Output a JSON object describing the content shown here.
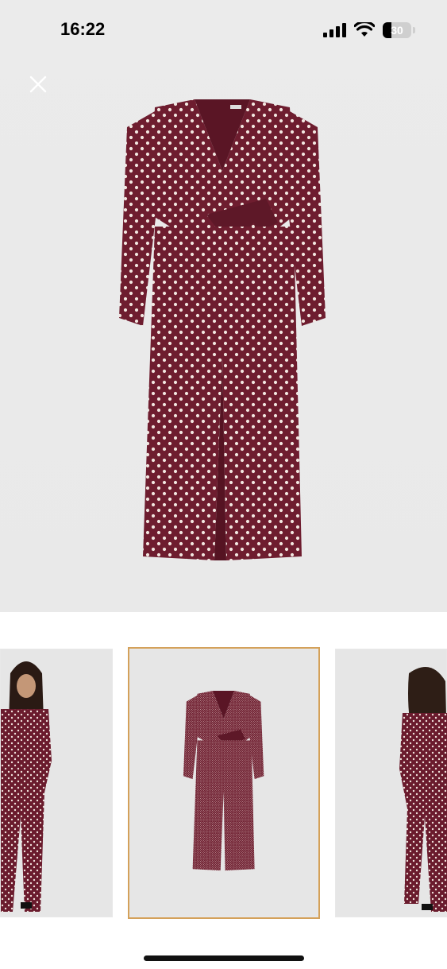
{
  "status_bar": {
    "time": "16:22",
    "battery_level": "30",
    "signal_bars": 4,
    "icons": [
      "signal-icon",
      "wifi-icon",
      "battery-icon"
    ]
  },
  "header": {
    "close_icon": "close-icon"
  },
  "product": {
    "main_image": "polka-dot-wrap-jumpsuit-image",
    "colors": {
      "fabric": "#6e1d2f",
      "dot": "#f2e6e0",
      "background": "#ebebeb",
      "selected_outline": "#d4a15a"
    }
  },
  "thumbnails": [
    {
      "name": "model-front-thumbnail",
      "selected": false
    },
    {
      "name": "product-flat-thumbnail",
      "selected": true
    },
    {
      "name": "model-back-thumbnail",
      "selected": false
    }
  ]
}
